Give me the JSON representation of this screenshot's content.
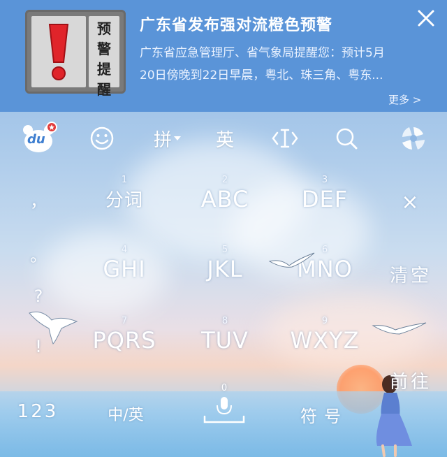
{
  "banner": {
    "badge_chars": [
      "预",
      "警",
      "提",
      "醒"
    ],
    "title": "广东省发布强对流橙色预警",
    "body_line1": "广东省应急管理厅、省气象局提醒您：预计5月",
    "body_line2": "20日傍晚到22日早晨，粤北、珠三角、粤东...",
    "more": "更多 >",
    "close_icon": "close-icon"
  },
  "toolbar": {
    "logo_icon": "du-logo-icon",
    "logo_text": "du",
    "emoji_icon": "smiley-icon",
    "pinyin": "拼",
    "english": "英",
    "cursor_icon": "text-cursor-icon",
    "search_icon": "search-icon",
    "swirl_icon": "swirl-logo-icon"
  },
  "keys": {
    "row1": [
      {
        "num": "1",
        "label": "分词"
      },
      {
        "num": "2",
        "label": "ABC"
      },
      {
        "num": "3",
        "label": "DEF"
      }
    ],
    "row2": [
      {
        "num": "4",
        "label": "GHI"
      },
      {
        "num": "5",
        "label": "JKL"
      },
      {
        "num": "6",
        "label": "MNO"
      }
    ],
    "row3": [
      {
        "num": "7",
        "label": "PQRS"
      },
      {
        "num": "8",
        "label": "TUV"
      },
      {
        "num": "9",
        "label": "WXYZ"
      }
    ]
  },
  "side_punct": {
    "comma": "，",
    "period": "。",
    "question": "?",
    "exclaim": "!"
  },
  "side_right": {
    "delete": "×",
    "clear": "清空",
    "go": "前往"
  },
  "bottom": {
    "numbers": "123",
    "lang_switch": "中/英",
    "space_num": "0",
    "mic_icon": "microphone-icon",
    "symbols": "符号"
  }
}
